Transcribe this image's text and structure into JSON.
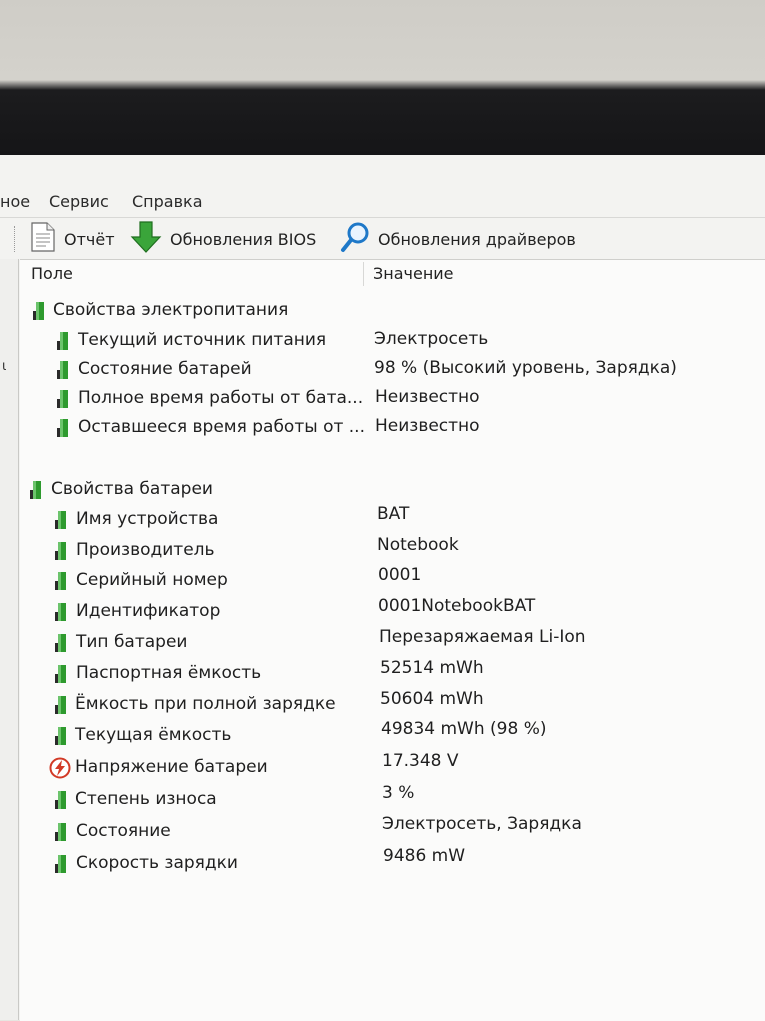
{
  "menu": {
    "items": [
      "ное",
      "Сервис",
      "Справка"
    ]
  },
  "toolbar": {
    "report_label": "Отчёт",
    "bios_label": "Обновления BIOS",
    "drivers_label": "Обновления драйверов"
  },
  "left_strip_mark": "ι",
  "columns": {
    "field": "Поле",
    "value": "Значение"
  },
  "power_section": {
    "title": "Свойства электропитания",
    "rows": [
      {
        "field": "Текущий источник питания",
        "value": "Электросеть"
      },
      {
        "field": "Состояние батарей",
        "value": "98 % (Высокий уровень, Зарядка)"
      },
      {
        "field": "Полное время работы от бата...",
        "value": "Неизвестно"
      },
      {
        "field": "Оставшееся время работы от ...",
        "value": "Неизвестно"
      }
    ]
  },
  "battery_section": {
    "title": "Свойства батареи",
    "rows": [
      {
        "field": "Имя устройства",
        "value": "BAT",
        "icon": "battery-icon"
      },
      {
        "field": "Производитель",
        "value": "Notebook",
        "icon": "battery-icon"
      },
      {
        "field": "Серийный номер",
        "value": "0001",
        "icon": "battery-icon"
      },
      {
        "field": "Идентификатор",
        "value": "0001NotebookBAT",
        "icon": "battery-icon"
      },
      {
        "field": "Тип батареи",
        "value": "Перезаряжаемая Li-Ion",
        "icon": "battery-icon"
      },
      {
        "field": "Паспортная ёмкость",
        "value": "52514 mWh",
        "icon": "battery-icon"
      },
      {
        "field": "Ёмкость при полной зарядке",
        "value": "50604 mWh",
        "icon": "battery-icon"
      },
      {
        "field": "Текущая ёмкость",
        "value": "49834 mWh  (98 %)",
        "icon": "battery-icon"
      },
      {
        "field": "Напряжение батареи",
        "value": "17.348 V",
        "icon": "voltage-icon"
      },
      {
        "field": "Степень износа",
        "value": "3 %",
        "icon": "battery-icon"
      },
      {
        "field": "Состояние",
        "value": "Электросеть, Зарядка",
        "icon": "battery-icon"
      },
      {
        "field": "Скорость зарядки",
        "value": "9486 mW",
        "icon": "battery-icon"
      }
    ]
  },
  "colors": {
    "battery_green": "#2e9a2e",
    "battery_dark": "#2a2a2a",
    "voltage_red": "#d23a26",
    "search_blue": "#1e78c8"
  }
}
